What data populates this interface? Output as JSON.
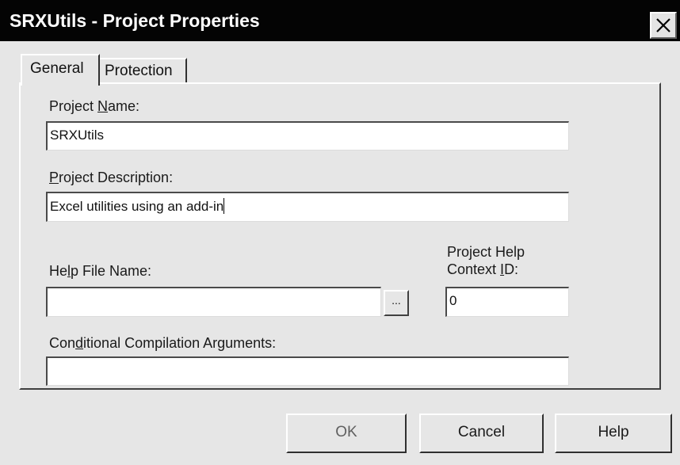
{
  "window": {
    "title": "SRXUtils - Project Properties",
    "close_label": "×"
  },
  "tabs": [
    {
      "label": "General",
      "active": true
    },
    {
      "label": "Protection",
      "active": false
    }
  ],
  "fields": {
    "project_name": {
      "label_pre": "Project ",
      "label_hotkey": "N",
      "label_post": "ame:",
      "value": "SRXUtils"
    },
    "project_description": {
      "label_pre": "",
      "label_hotkey": "P",
      "label_post": "roject Description:",
      "value": "Excel utilities using an add-in"
    },
    "help_file_name": {
      "label_pre": "He",
      "label_hotkey": "l",
      "label_post": "p File Name:",
      "value": "",
      "browse_label": "..."
    },
    "help_context_id": {
      "label_line1": "Project Help",
      "label_pre": "Context ",
      "label_hotkey": "I",
      "label_post": "D:",
      "value": "0"
    },
    "conditional_compilation": {
      "label_pre": "Con",
      "label_hotkey": "d",
      "label_post": "itional Compilation Arguments:",
      "value": ""
    }
  },
  "buttons": {
    "ok": "OK",
    "cancel": "Cancel",
    "help": "Help"
  },
  "colors": {
    "titlebar": "#040404",
    "dialog_bg": "#e6e6e6",
    "field_bg": "#ffffff"
  }
}
